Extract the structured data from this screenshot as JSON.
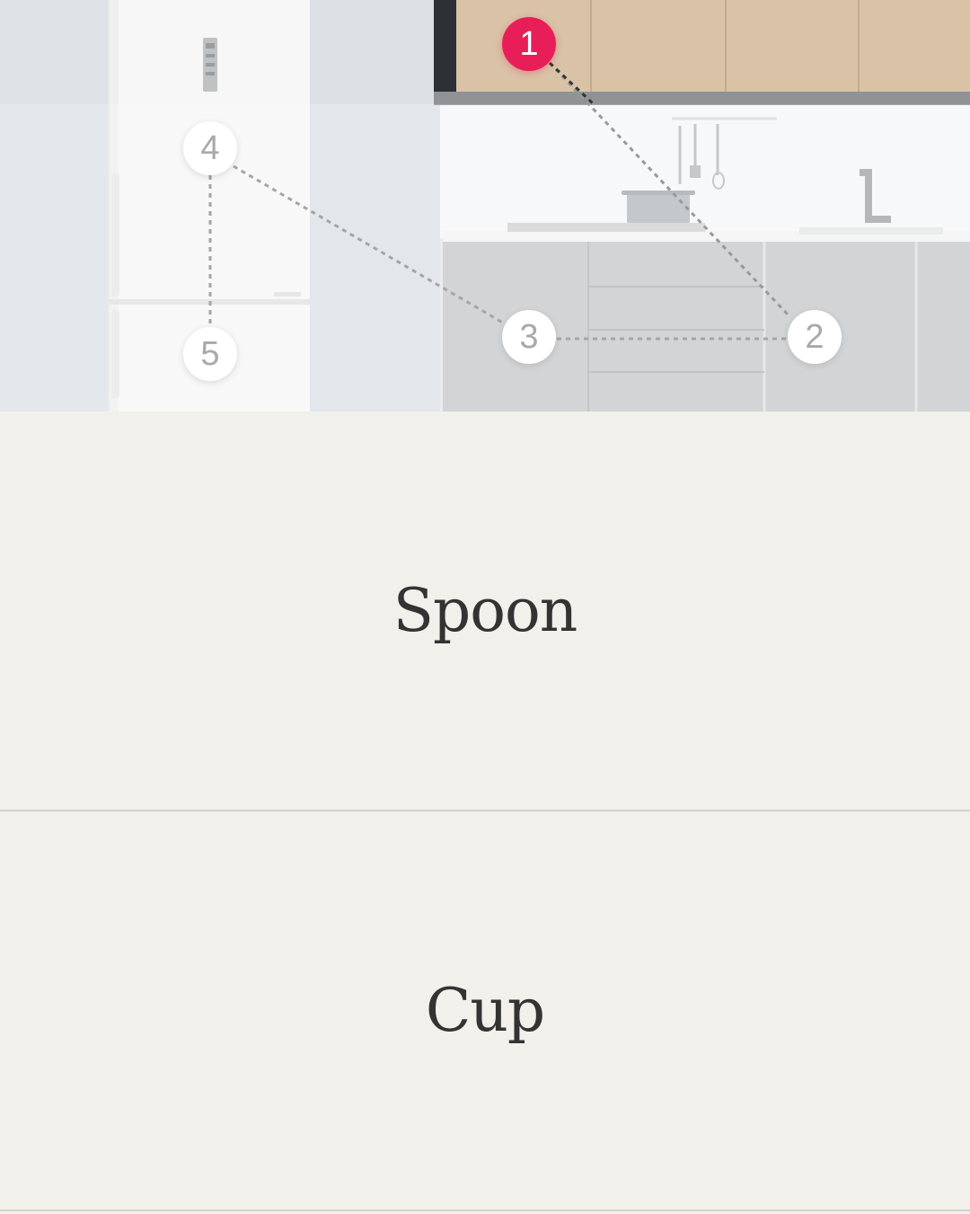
{
  "hero": {
    "hotspots": [
      {
        "label": "1",
        "active": true
      },
      {
        "label": "2",
        "active": false
      },
      {
        "label": "3",
        "active": false
      },
      {
        "label": "4",
        "active": false
      },
      {
        "label": "5",
        "active": false
      }
    ],
    "colors": {
      "active": "#e81e59",
      "inactive_text": "#a9a9a9"
    }
  },
  "panels": [
    {
      "label": "Spoon"
    },
    {
      "label": "Cup"
    }
  ]
}
